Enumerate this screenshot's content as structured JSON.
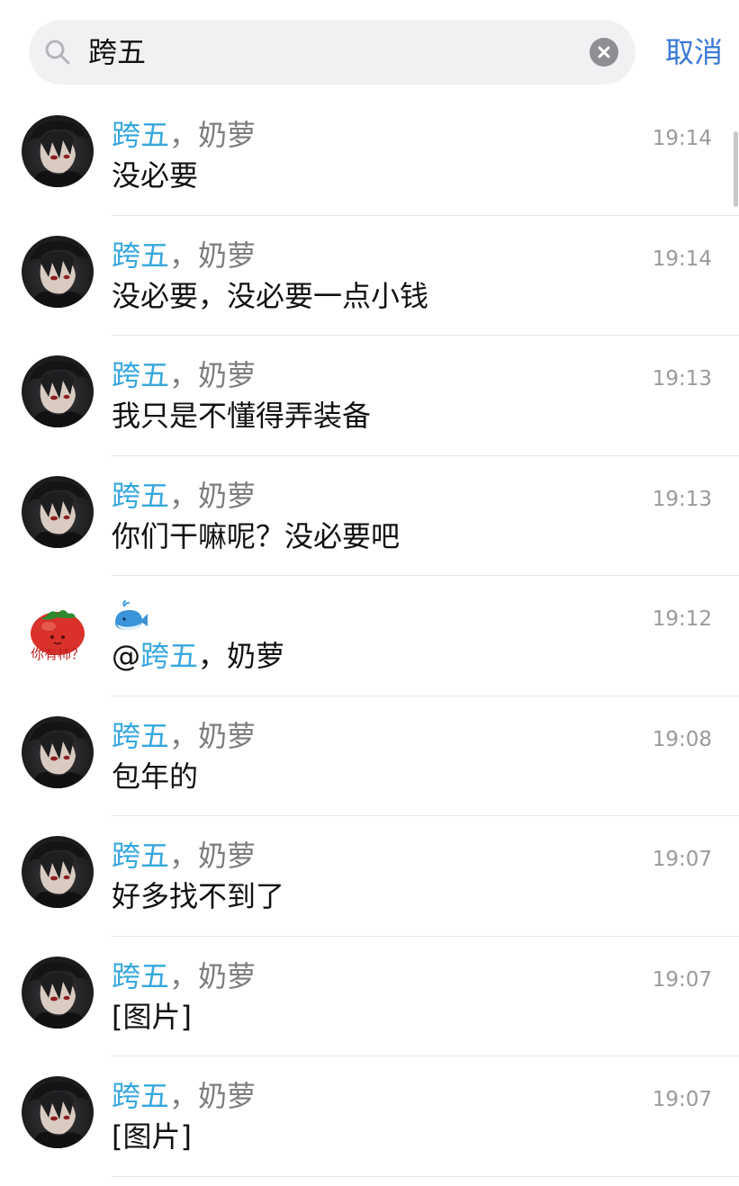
{
  "search": {
    "query": "跨五",
    "cancel_label": "取消"
  },
  "results": [
    {
      "name_highlight": "跨五",
      "name_rest": "，奶萝",
      "message": "没必要",
      "time": "19:14",
      "avatar": "dark-hair-avatar"
    },
    {
      "name_highlight": "跨五",
      "name_rest": "，奶萝",
      "message": "没必要，没必要一点小钱",
      "time": "19:14",
      "avatar": "dark-hair-avatar"
    },
    {
      "name_highlight": "跨五",
      "name_rest": "，奶萝",
      "message": "我只是不懂得弄装备",
      "time": "19:13",
      "avatar": "dark-hair-avatar"
    },
    {
      "name_highlight": "跨五",
      "name_rest": "，奶萝",
      "message": "你们干嘛呢？没必要吧",
      "time": "19:13",
      "avatar": "dark-hair-avatar"
    },
    {
      "name_icon": "whale-icon",
      "message_prefix": "@",
      "message_highlight": "跨五",
      "message_rest": "，奶萝",
      "time": "19:12",
      "avatar": "tomato-avatar",
      "avatar_text": "你有柿？"
    },
    {
      "name_highlight": "跨五",
      "name_rest": "，奶萝",
      "message": "包年的",
      "time": "19:08",
      "avatar": "dark-hair-avatar"
    },
    {
      "name_highlight": "跨五",
      "name_rest": "，奶萝",
      "message": "好多找不到了",
      "time": "19:07",
      "avatar": "dark-hair-avatar"
    },
    {
      "name_highlight": "跨五",
      "name_rest": "，奶萝",
      "message": "[图片]",
      "time": "19:07",
      "avatar": "dark-hair-avatar"
    },
    {
      "name_highlight": "跨五",
      "name_rest": "，奶萝",
      "message": "[图片]",
      "time": "19:07",
      "avatar": "dark-hair-avatar"
    }
  ],
  "colors": {
    "highlight": "#37a7de",
    "accent": "#3a78d6",
    "secondary_text": "#7d7d7d",
    "time_text": "#9a9a9a"
  }
}
